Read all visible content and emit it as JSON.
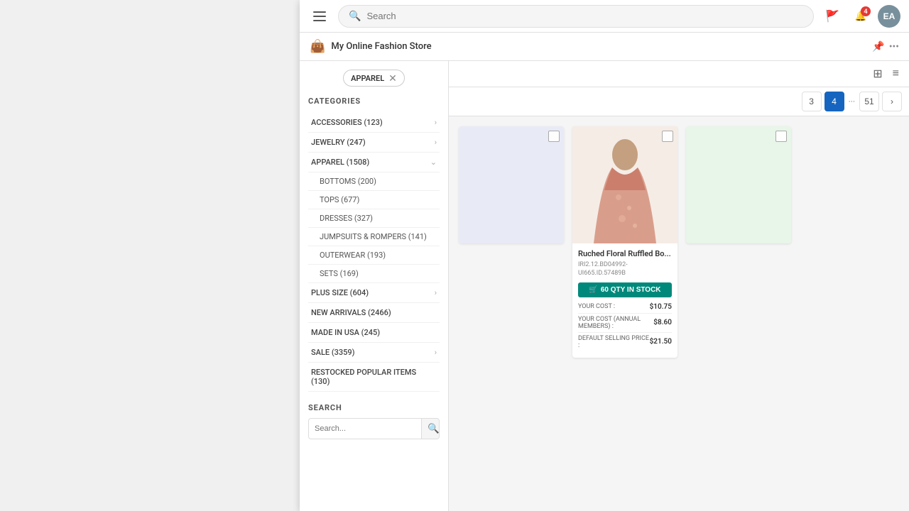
{
  "nav": {
    "search_placeholder": "Search",
    "notification_count": "4",
    "avatar_initials": "EA"
  },
  "store": {
    "name": "My Online Fashion Store",
    "logo": "👜"
  },
  "sidebar": {
    "active_filter": "APPAREL",
    "categories_title": "CATEGORIES",
    "categories": [
      {
        "label": "ACCESSORIES (123)",
        "has_children": true
      },
      {
        "label": "JEWELRY (247)",
        "has_children": true
      },
      {
        "label": "APPAREL (1508)",
        "has_children": true,
        "expanded": true
      },
      {
        "label": "PLUS SIZE (604)",
        "has_children": true
      },
      {
        "label": "NEW ARRIVALS (2466)",
        "has_children": false
      },
      {
        "label": "MADE IN USA (245)",
        "has_children": false
      },
      {
        "label": "SALE (3359)",
        "has_children": true
      },
      {
        "label": "RESTOCKED POPULAR ITEMS (130)",
        "has_children": false
      }
    ],
    "subcategories": [
      {
        "label": "BOTTOMS (200)"
      },
      {
        "label": "TOPS (677)"
      },
      {
        "label": "DRESSES (327)"
      },
      {
        "label": "JUMPSUITS & ROMPERS (141)"
      },
      {
        "label": "OUTERWEAR (193)"
      },
      {
        "label": "SETS (169)"
      }
    ],
    "search_title": "SEARCH",
    "search_placeholder": "Search..."
  },
  "pagination": {
    "pages": [
      "3",
      "4",
      "51"
    ],
    "active_page": "4",
    "dots": "···",
    "next_label": "›"
  },
  "product": {
    "name": "Ruched Floral Ruffled Bo...",
    "sku": "IRI2.12.BD04992-UI665.ID.57489B",
    "stock_label": "60 QTY IN STOCK",
    "cost_label": "YOUR COST :",
    "cost_value": "$10.75",
    "annual_label": "YOUR COST (ANNUAL MEMBERS) :",
    "annual_value": "$8.60",
    "default_price_label": "DEFAULT SELLING PRICE :",
    "default_price_value": "$21.50"
  },
  "toolbar": {
    "view_grid": "⊞",
    "view_list": "≡"
  }
}
